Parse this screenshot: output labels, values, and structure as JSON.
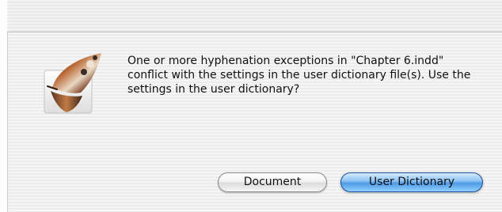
{
  "dialog": {
    "message": "One or more hyphenation exceptions in \"Chapter 6.indd\" conflict with the settings in the user dictionary file(s). Use the settings in the user dictionary?",
    "icon": "indesign-butterfly-icon"
  },
  "buttons": {
    "document_label": "Document",
    "user_dictionary_label": "User Dictionary"
  },
  "colors": {
    "default_button": "#5aa3ea",
    "default_button_border": "#1f4f9e"
  }
}
